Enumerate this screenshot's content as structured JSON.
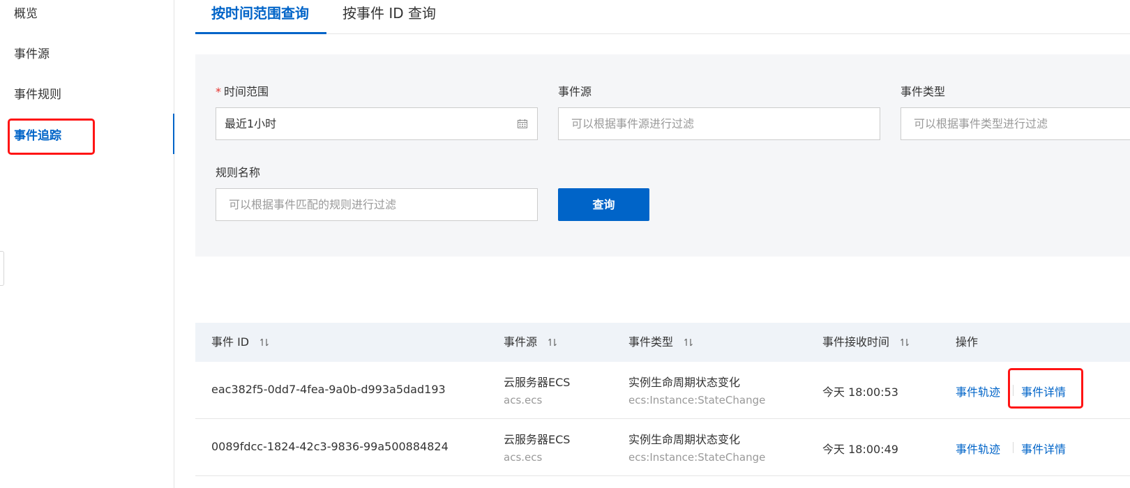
{
  "sidebar": {
    "items": [
      {
        "label": "概览"
      },
      {
        "label": "事件源"
      },
      {
        "label": "事件规则"
      },
      {
        "label": "事件追踪"
      }
    ]
  },
  "tabs": [
    {
      "label": "按时间范围查询"
    },
    {
      "label": "按事件 ID 查询"
    }
  ],
  "filters": {
    "time_range": {
      "required_mark": "*",
      "label": "时间范围",
      "value": "最近1小时"
    },
    "event_source": {
      "label": "事件源",
      "placeholder": "可以根据事件源进行过滤"
    },
    "event_type": {
      "label": "事件类型",
      "placeholder": "可以根据事件类型进行过滤"
    },
    "rule_name": {
      "label": "规则名称",
      "placeholder": "可以根据事件匹配的规则进行过滤"
    },
    "query_button": "查询"
  },
  "table": {
    "columns": [
      "事件 ID",
      "事件源",
      "事件类型",
      "事件接收时间",
      "操作"
    ],
    "rows": [
      {
        "id": "eac382f5-0dd7-4fea-9a0b-d993a5dad193",
        "source": "云服务器ECS",
        "source_code": "acs.ecs",
        "type": "实例生命周期状态变化",
        "type_code": "ecs:Instance:StateChange",
        "time": "今天 18:00:53",
        "action_trace": "事件轨迹",
        "action_detail": "事件详情"
      },
      {
        "id": "0089fdcc-1824-42c3-9836-99a500884824",
        "source": "云服务器ECS",
        "source_code": "acs.ecs",
        "type": "实例生命周期状态变化",
        "type_code": "ecs:Instance:StateChange",
        "time": "今天 18:00:49",
        "action_trace": "事件轨迹",
        "action_detail": "事件详情"
      }
    ]
  },
  "colors": {
    "accent": "#0064c8",
    "highlight": "#ff1414",
    "panel_bg": "#f5f6f8",
    "table_header_bg": "#eff3f8"
  }
}
